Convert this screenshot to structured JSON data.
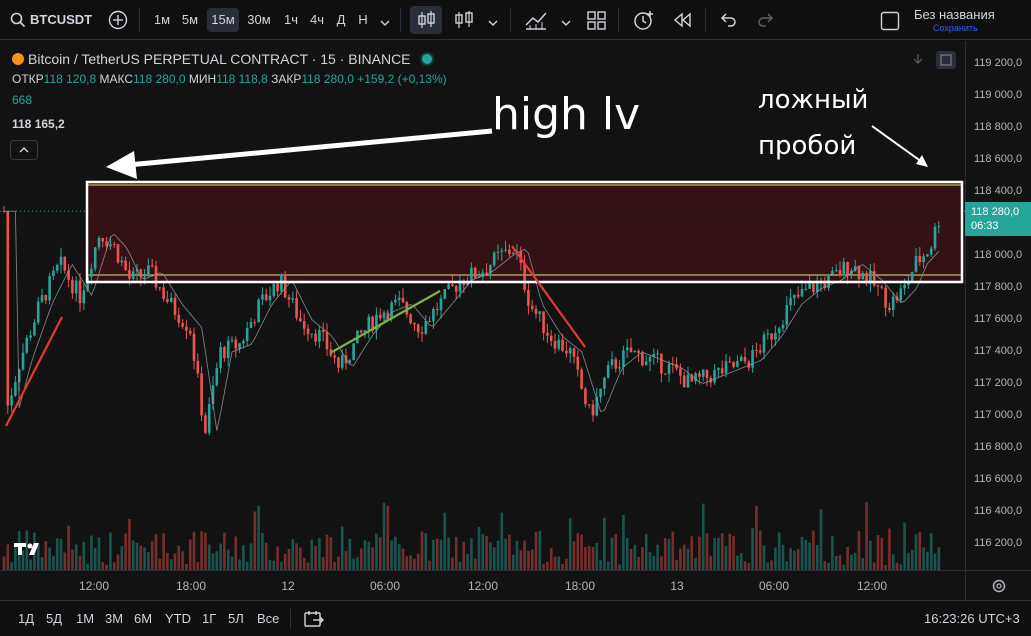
{
  "toolbar": {
    "symbol": "BTCUSDT",
    "intervals": [
      "1м",
      "5м",
      "15м",
      "30м",
      "1ч",
      "4ч",
      "Д",
      "Н"
    ],
    "active_interval": "15м",
    "layout_name": "Без названия",
    "save_label": "Сохранить"
  },
  "legend": {
    "title": "Bitcoin / TetherUS PERPETUAL CONTRACT · 15 · BINANCE",
    "open_label": "ОТКР",
    "open": "118 120,8",
    "high_label": "МАКС",
    "high": "118 280,0",
    "low_label": "МИН",
    "low": "118 118,8",
    "close_label": "ЗАКР",
    "close": "118 280,0",
    "change": "+159,2 (+0,13%)",
    "volume": "668",
    "indicator_value": "118 165,2"
  },
  "annotations": {
    "high_lv": "high lv",
    "false_break_line1": "ложный",
    "false_break_line2": "пробой"
  },
  "price_scale": {
    "labels": [
      "119 200,0",
      "119 000,0",
      "118 800,0",
      "118 600,0",
      "118 400,0",
      "118 200,0",
      "118 000,0",
      "117 800,0",
      "117 600,0",
      "117 400,0",
      "117 200,0",
      "117 000,0",
      "116 800,0",
      "116 600,0",
      "116 400,0",
      "116 200,0"
    ],
    "current_price": "118 280,0",
    "countdown": "06:33"
  },
  "time_scale": {
    "labels": [
      "12:00",
      "18:00",
      "12",
      "06:00",
      "12:00",
      "18:00",
      "13",
      "06:00",
      "12:00"
    ]
  },
  "bottom_bar": {
    "ranges": [
      "1Д",
      "5Д",
      "1М",
      "3М",
      "6М",
      "YTD",
      "1Г",
      "5Л",
      "Все"
    ],
    "clock": "16:23:26 UTC+3"
  },
  "colors": {
    "up": "#26a69a",
    "down": "#ef5350",
    "zone_fill": "#3a1216",
    "zone_line": "#e8e56a"
  }
}
